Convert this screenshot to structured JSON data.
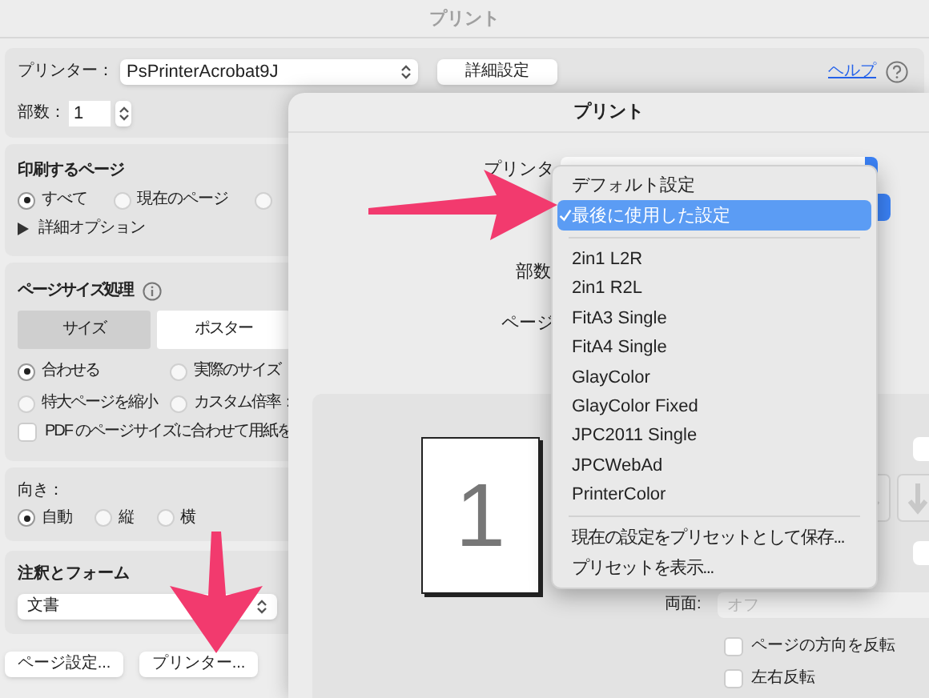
{
  "back_window": {
    "title": "プリント",
    "printer_label": "プリンター：",
    "printer": "PsPrinterAcrobat9J",
    "details_button": "詳細設定",
    "help_link": "ヘルプ",
    "copies_label": "部数：",
    "copies": "1",
    "pages": {
      "title": "印刷するページ",
      "options": [
        {
          "label": "すべて",
          "selected": true
        },
        {
          "label": "現在のページ",
          "selected": false
        },
        {
          "selected": false
        }
      ],
      "more_options": "詳細オプション"
    },
    "page_sizing": {
      "title": "ページサイズ処理",
      "tabs": [
        {
          "label": "サイズ",
          "selected": true
        },
        {
          "label": "ポスター",
          "selected": false
        }
      ],
      "options": [
        {
          "label": "合わせる",
          "selected": true
        },
        {
          "label": "実際のサイズ",
          "selected": false
        },
        {
          "label": "特大ページを縮小",
          "selected": false
        },
        {
          "label": "カスタム倍率：",
          "selected": false
        }
      ],
      "fit_paper": {
        "label": "PDF のページサイズに合わせて用紙を",
        "checked": false
      }
    },
    "orientation": {
      "title": "向き：",
      "options": [
        {
          "label": "自動",
          "selected": true
        },
        {
          "label": "縦",
          "selected": false
        },
        {
          "label": "横",
          "selected": false
        }
      ]
    },
    "comments_forms": {
      "title": "注釈とフォーム",
      "value": "文書"
    },
    "buttons": [
      "ページ設定...",
      "プリンター..."
    ]
  },
  "front_sheet": {
    "title": "プリント",
    "printer_label": "プリンタ",
    "copies_label": "部数",
    "pages_label": "ページ",
    "preview_page": "1",
    "duplex_label": "両面:",
    "duplex_placeholder": "オフ",
    "checkboxes": [
      {
        "label": "ページの方向を反転",
        "checked": false
      },
      {
        "label": "左右反転",
        "checked": false
      }
    ]
  },
  "preset_menu": {
    "sections": [
      [
        {
          "label": "デフォルト設定",
          "selected": false
        },
        {
          "label": "最後に使用した設定",
          "selected": true
        }
      ],
      [
        {
          "label": "2in1 L2R",
          "selected": false
        },
        {
          "label": "2in1 R2L",
          "selected": false
        },
        {
          "label": "FitA3 Single",
          "selected": false
        },
        {
          "label": "FitA4 Single",
          "selected": false
        },
        {
          "label": "GlayColor",
          "selected": false
        },
        {
          "label": "GlayColor Fixed",
          "selected": false
        },
        {
          "label": "JPC2011  Single",
          "selected": false
        },
        {
          "label": "JPCWebAd",
          "selected": false
        },
        {
          "label": "PrinterColor",
          "selected": false
        }
      ],
      [
        {
          "label": "現在の設定をプリセットとして保存...",
          "selected": false
        },
        {
          "label": "プリセットを表示...",
          "selected": false
        }
      ]
    ]
  }
}
